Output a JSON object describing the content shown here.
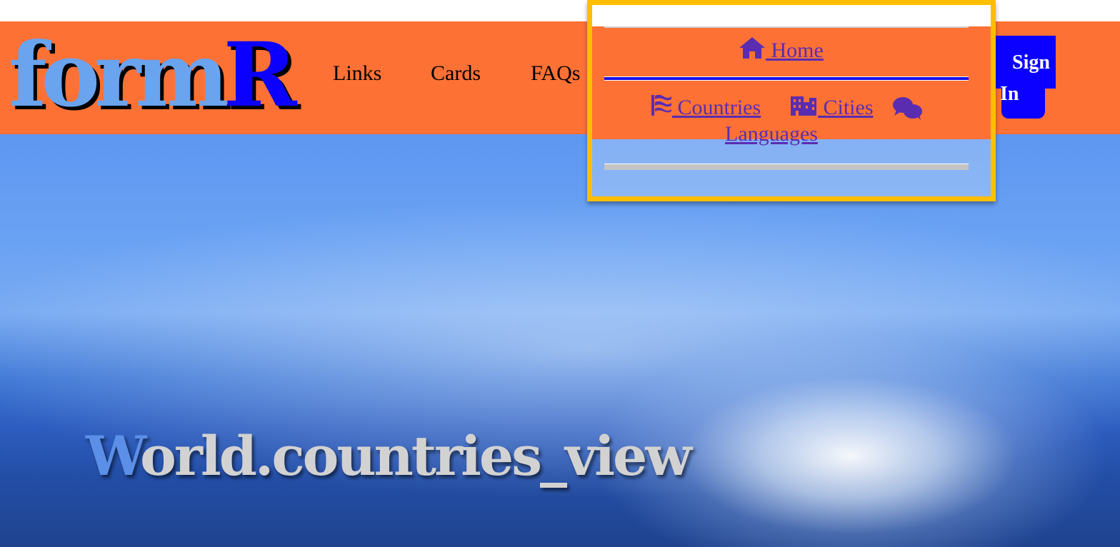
{
  "brand": {
    "logo_part1": "form",
    "logo_part2": "R"
  },
  "nav": {
    "links_label": "Links",
    "cards_label": "Cards",
    "faqs_label": "FAQs",
    "signin_word1": "Sign",
    "signin_word2": "In"
  },
  "dropdown": {
    "home_label": " Home",
    "countries_label": "  Countries",
    "cities_label": "  Cities",
    "languages_label": "  Languages"
  },
  "hero": {
    "title_first": "W",
    "title_rest": "orld.countries_view"
  },
  "icons": {
    "home": "home-icon",
    "countries": "flag-icon",
    "cities": "city-icon",
    "languages": "comments-icon"
  },
  "colors": {
    "navbar": "#fe7135",
    "logo_primary": "#6aa3ee",
    "logo_accent": "#0b00ff",
    "signin_bg": "#0b00ff",
    "dropdown_border": "#ffbe00",
    "dropdown_link": "#5a2db0",
    "hero_title": "#d2d2d2",
    "hero_title_first": "#5b8fe8"
  }
}
